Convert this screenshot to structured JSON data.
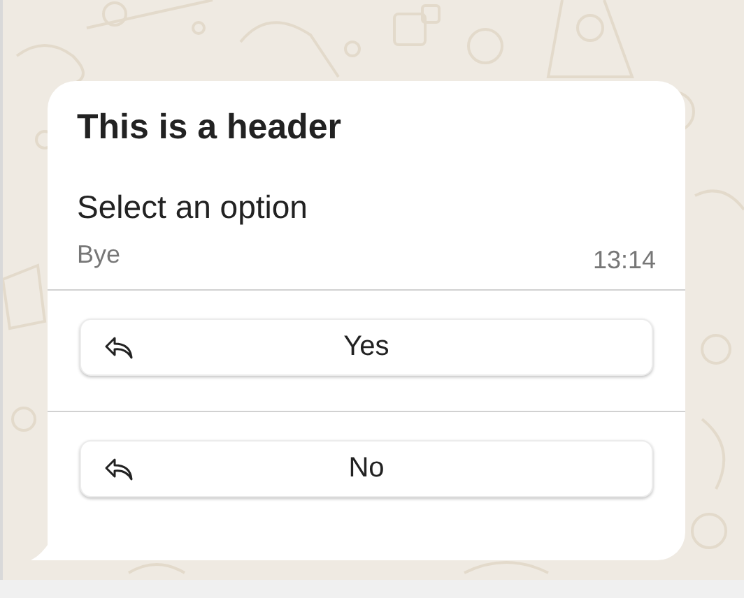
{
  "message": {
    "header": "This is a header",
    "body": "Select an option",
    "footer": "Bye",
    "time": "13:14"
  },
  "buttons": [
    {
      "label": "Yes"
    },
    {
      "label": "No"
    }
  ]
}
